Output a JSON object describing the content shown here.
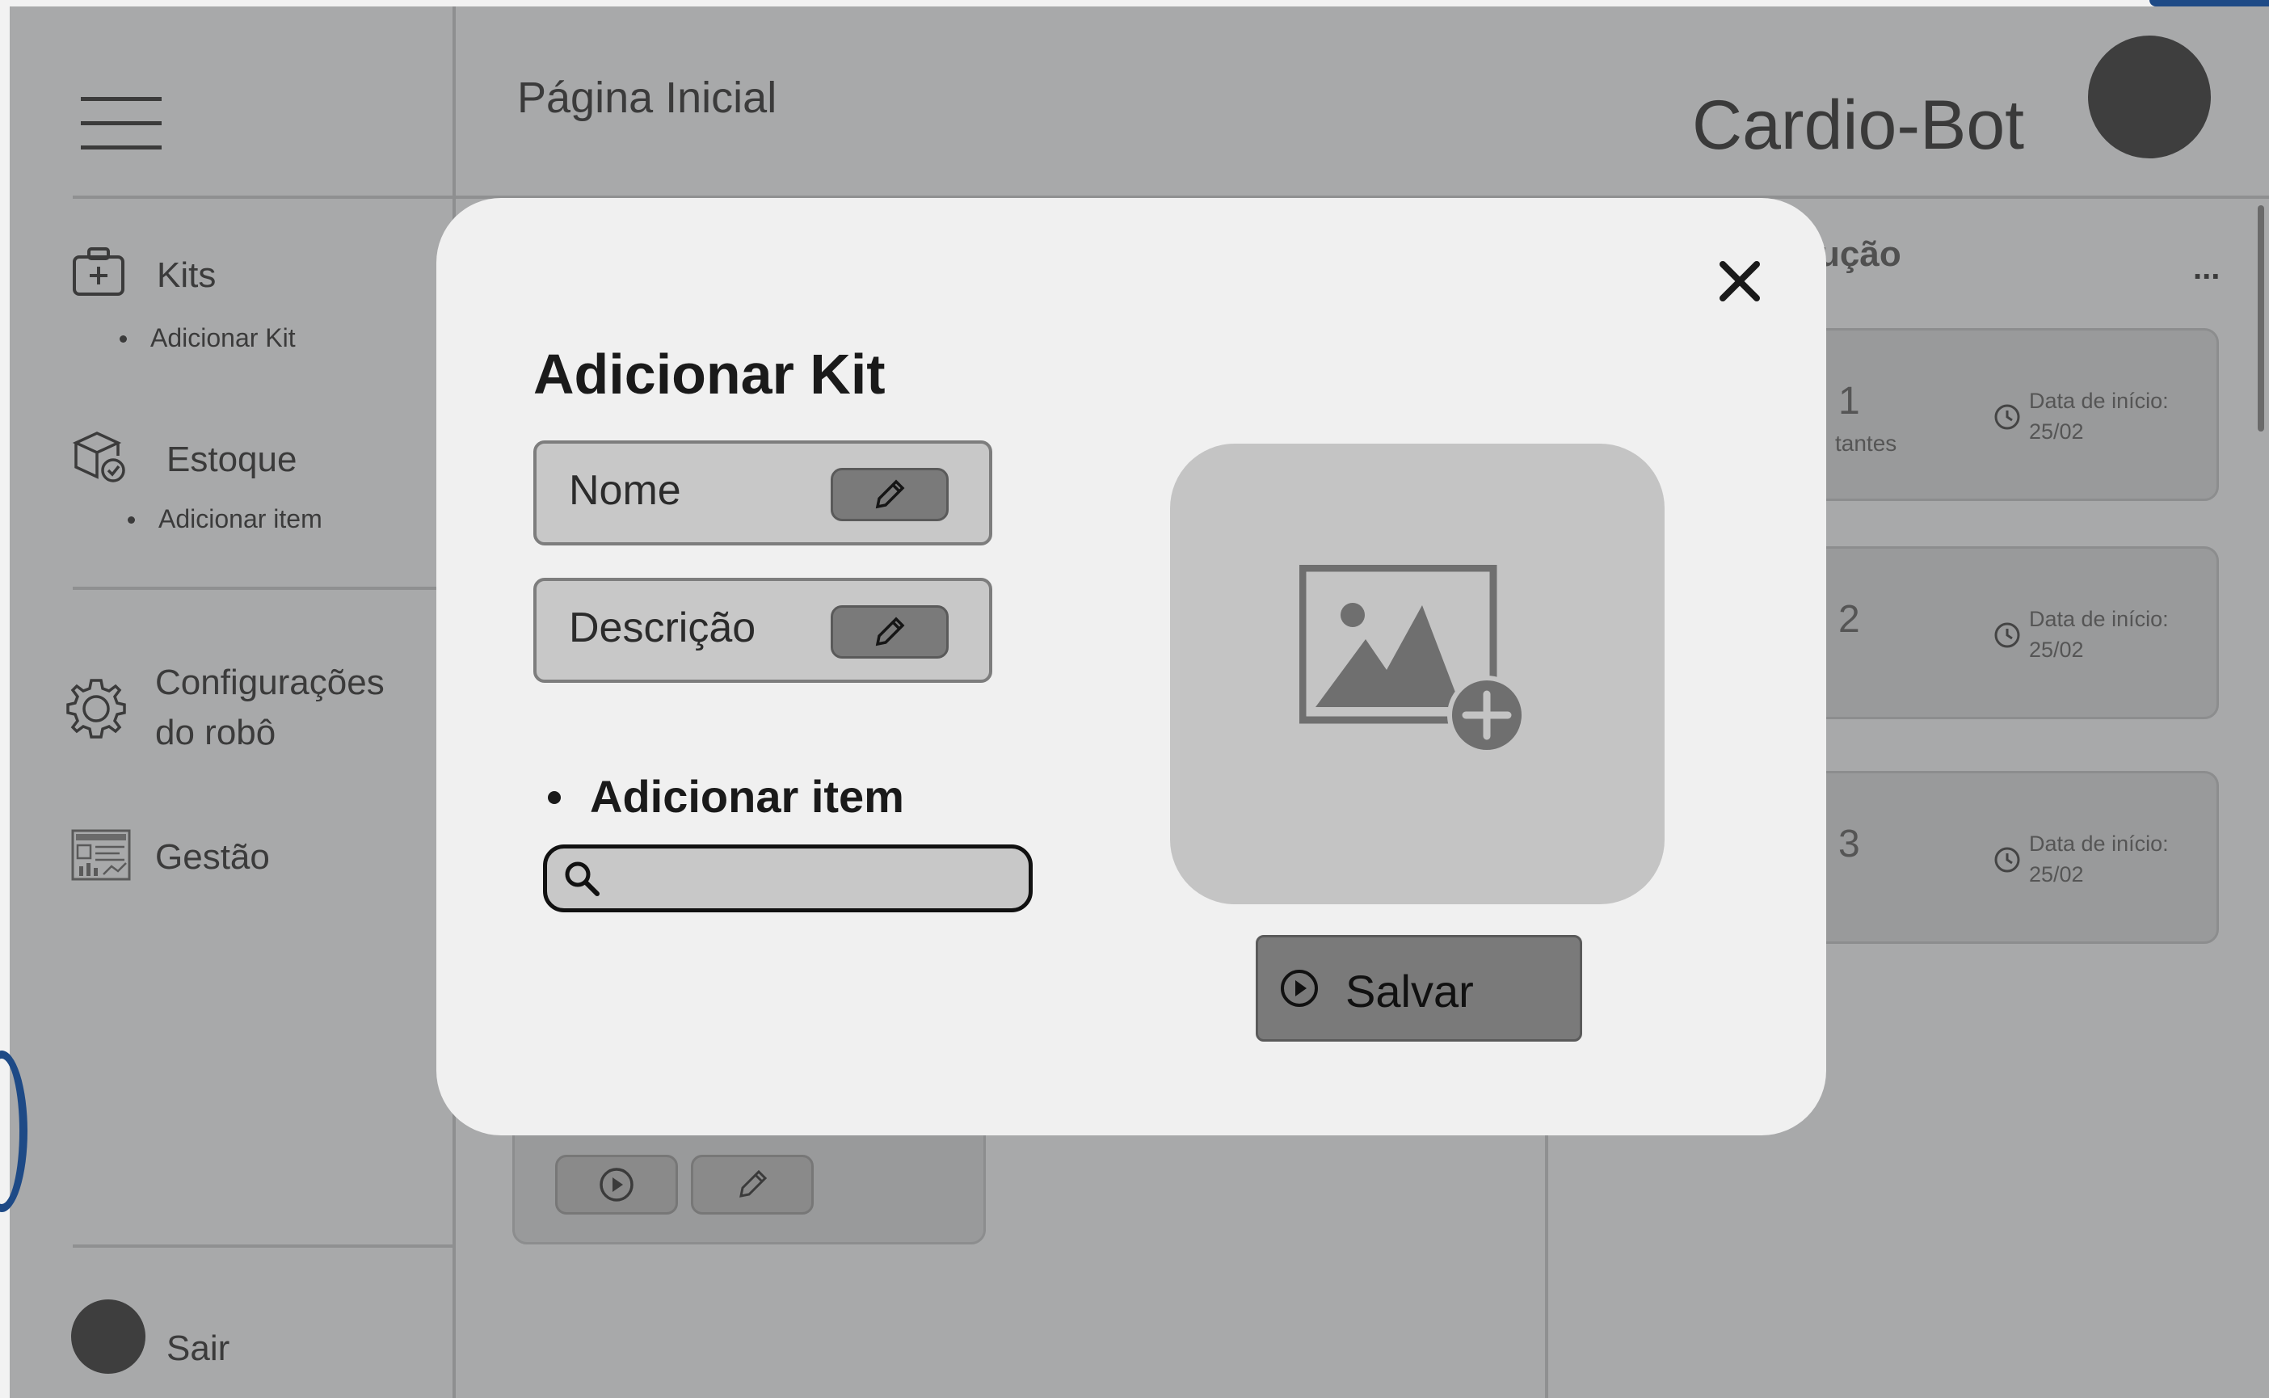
{
  "app": {
    "brand": "Cardio-Bot",
    "page_title": "Página Inicial"
  },
  "sidebar": {
    "items": [
      {
        "label": "Kits",
        "sub": "Adicionar Kit"
      },
      {
        "label": "Estoque",
        "sub": "Adicionar item"
      },
      {
        "label_line1": "Configurações",
        "label_line2": "do robô"
      },
      {
        "label": "Gestão"
      }
    ],
    "logout": "Sair"
  },
  "right_panel": {
    "title_fragment": "ução",
    "more": "...",
    "cards": [
      {
        "number_fragment": "1",
        "sub_fragment": "tantes",
        "date_label": "Data de início:",
        "date": "25/02"
      },
      {
        "number_fragment": "2",
        "date_label": "Data de início:",
        "date": "25/02"
      },
      {
        "number_fragment": "3",
        "date_label": "Data de início:",
        "date": "25/02"
      }
    ]
  },
  "modal": {
    "title": "Adicionar Kit",
    "close": "✕",
    "fields": [
      {
        "label": "Nome"
      },
      {
        "label": "Descrição"
      }
    ],
    "add_item_label": "Adicionar item",
    "search_value": "",
    "save_label": "Salvar"
  },
  "colors": {
    "background": "#a8a9aa",
    "modal": "#f0f0f0",
    "button": "#7a7a7a",
    "outer_blue": "#1e4a86"
  }
}
